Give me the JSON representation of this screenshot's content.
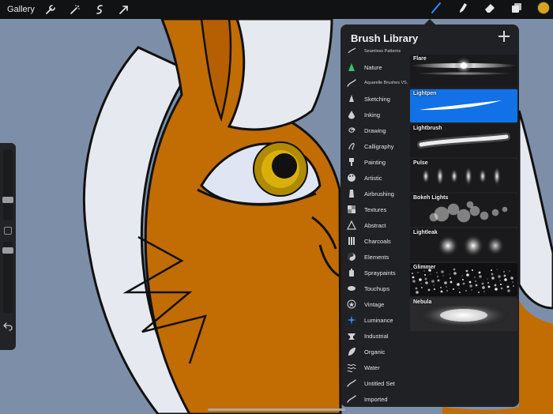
{
  "toolbar": {
    "gallery_label": "Gallery",
    "left_tools": [
      {
        "name": "wrench-icon"
      },
      {
        "name": "magic-wand-icon"
      },
      {
        "name": "selection-icon"
      },
      {
        "name": "transform-arrow-icon"
      }
    ],
    "right_tools": [
      {
        "name": "brush-icon",
        "active": true
      },
      {
        "name": "smudge-icon"
      },
      {
        "name": "eraser-icon"
      },
      {
        "name": "layers-icon"
      }
    ],
    "current_color": "#d7a41c",
    "accent": "#1271e6"
  },
  "sidebar": {
    "brush_size_icon": "size-slider",
    "modify_icon": "square-icon",
    "opacity_icon": "opacity-slider",
    "undo_icon": "undo-icon"
  },
  "brush_library": {
    "title": "Brush Library",
    "sets": [
      {
        "label": "Seamless Patterns",
        "icon": "pattern-icon",
        "small": true
      },
      {
        "label": "Nature",
        "icon": "nature-icon"
      },
      {
        "label": "Aquarelle Brushes VS...",
        "icon": "stroke-icon",
        "small": true
      },
      {
        "label": "Sketching",
        "icon": "pencil-icon"
      },
      {
        "label": "Inking",
        "icon": "ink-drop-icon"
      },
      {
        "label": "Drawing",
        "icon": "spiral-icon"
      },
      {
        "label": "Calligraphy",
        "icon": "calligraphy-icon"
      },
      {
        "label": "Painting",
        "icon": "paint-brush-icon"
      },
      {
        "label": "Artistic",
        "icon": "palette-icon"
      },
      {
        "label": "Airbrushing",
        "icon": "airbrush-icon"
      },
      {
        "label": "Textures",
        "icon": "texture-icon"
      },
      {
        "label": "Abstract",
        "icon": "triangle-icon"
      },
      {
        "label": "Charcoals",
        "icon": "charcoal-icon"
      },
      {
        "label": "Elements",
        "icon": "yin-yang-icon"
      },
      {
        "label": "Spraypaints",
        "icon": "spray-can-icon"
      },
      {
        "label": "Touchups",
        "icon": "touchup-icon"
      },
      {
        "label": "Vintage",
        "icon": "star-badge-icon"
      },
      {
        "label": "Luminance",
        "icon": "sparkle-icon",
        "active": true
      },
      {
        "label": "Industrial",
        "icon": "anvil-icon"
      },
      {
        "label": "Organic",
        "icon": "leaf-icon"
      },
      {
        "label": "Water",
        "icon": "waves-icon"
      },
      {
        "label": "Untitled Set",
        "icon": "stroke-icon"
      },
      {
        "label": "Imported",
        "icon": "stroke-icon"
      }
    ],
    "brushes": [
      {
        "name": "Flare",
        "style": "flare"
      },
      {
        "name": "Lightpen",
        "style": "lightpen",
        "selected": true
      },
      {
        "name": "Lightbrush",
        "style": "lightbrush"
      },
      {
        "name": "Pulse",
        "style": "pulse"
      },
      {
        "name": "Bokeh Lights",
        "style": "bokeh"
      },
      {
        "name": "Lightleak",
        "style": "lightleak"
      },
      {
        "name": "Glimmer",
        "style": "glimmer"
      },
      {
        "name": "Nebula",
        "style": "nebula"
      }
    ]
  }
}
